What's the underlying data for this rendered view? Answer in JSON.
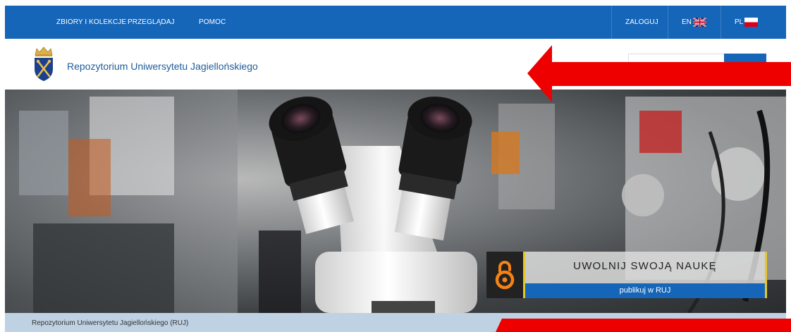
{
  "topnav": {
    "collections": "ZBIORY I KOLEKCJE",
    "browse": "PRZEGLĄDAJ",
    "help": "POMOC",
    "login": "ZALOGUJ",
    "lang_en": "EN",
    "lang_pl": "PL"
  },
  "header": {
    "site_title": "Repozytorium Uniwersytetu Jagiellońskiego"
  },
  "promo": {
    "title": "UWOLNIJ SWOJĄ NAUKĘ",
    "subtitle": "publikuj w RUJ"
  },
  "breadcrumb": {
    "text": "Repozytorium Uniwersytetu Jagiellońskiego (RUJ)"
  },
  "colors": {
    "brand_blue": "#1565b8",
    "breadcrumb_bg": "#bfd2e3",
    "accent_yellow": "#e5c72b",
    "annotation_red": "#ee0000"
  },
  "icons": [
    "uj-crest-logo-icon",
    "search-icon",
    "uk-flag-icon",
    "pl-flag-icon",
    "open-access-icon"
  ]
}
